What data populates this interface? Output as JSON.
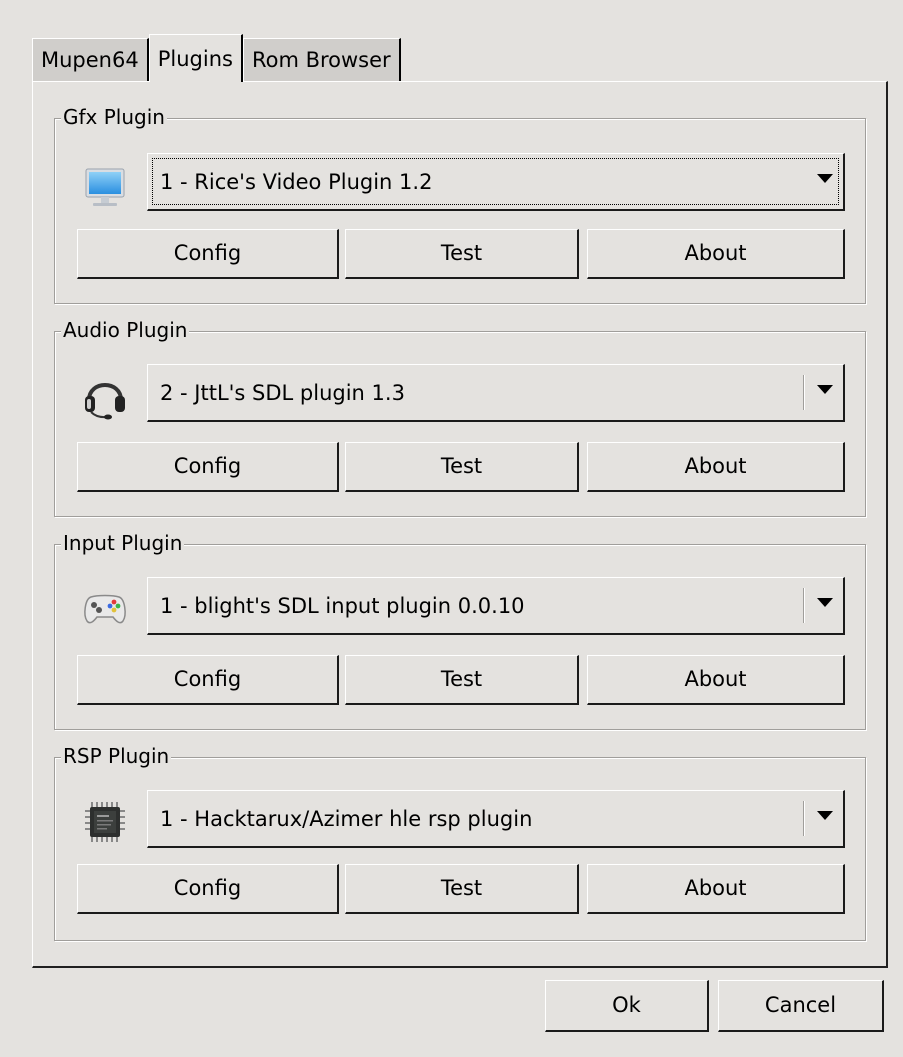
{
  "tabs": [
    {
      "label": "Mupen64",
      "active": false
    },
    {
      "label": "Plugins",
      "active": true
    },
    {
      "label": "Rom Browser",
      "active": false
    }
  ],
  "groups": [
    {
      "title": "Gfx Plugin",
      "icon": "monitor-icon",
      "selected": "1 - Rice's Video Plugin 1.2",
      "buttons": {
        "config": "Config",
        "test": "Test",
        "about": "About"
      }
    },
    {
      "title": "Audio Plugin",
      "icon": "headset-icon",
      "selected": "2 - JttL's SDL plugin 1.3",
      "buttons": {
        "config": "Config",
        "test": "Test",
        "about": "About"
      }
    },
    {
      "title": "Input Plugin",
      "icon": "gamepad-icon",
      "selected": "1 - blight's SDL input plugin 0.0.10",
      "buttons": {
        "config": "Config",
        "test": "Test",
        "about": "About"
      }
    },
    {
      "title": "RSP Plugin",
      "icon": "chip-icon",
      "selected": "1 - Hacktarux/Azimer hle rsp plugin",
      "buttons": {
        "config": "Config",
        "test": "Test",
        "about": "About"
      }
    }
  ],
  "footer": {
    "ok_label": "Ok",
    "cancel_label": "Cancel"
  },
  "colors": {
    "window_bg": "#e4e2df",
    "inactive_tab_bg": "#d0cecb",
    "frame_line": "#a09e9b"
  }
}
